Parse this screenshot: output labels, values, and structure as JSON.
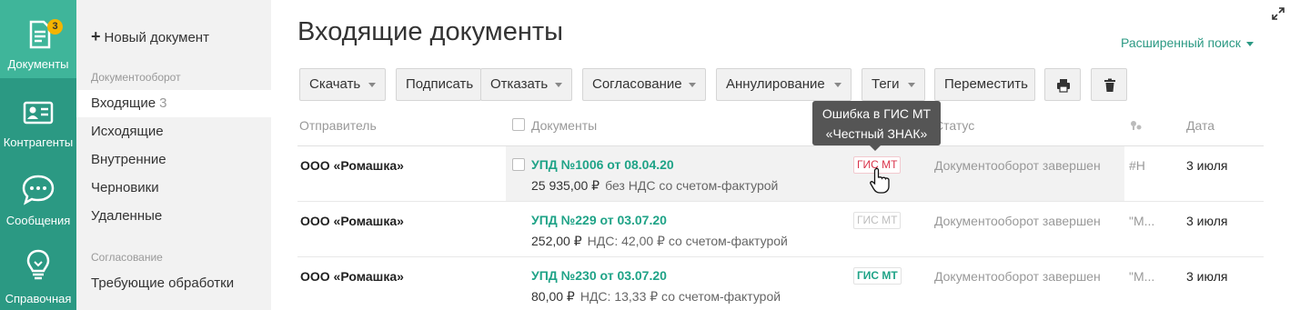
{
  "rail": {
    "items": [
      {
        "label": "Документы",
        "badge": "3",
        "icon": "document-icon",
        "active": true
      },
      {
        "label": "Контрагенты",
        "icon": "contacts-card-icon"
      },
      {
        "label": "Сообщения",
        "icon": "chat-bubble-icon"
      },
      {
        "label": "Справочная",
        "icon": "lightbulb-icon"
      }
    ]
  },
  "nav": {
    "new_doc": "Новый документ",
    "group1": "Документооборот",
    "items": [
      {
        "label": "Входящие",
        "count": "3"
      },
      {
        "label": "Исходящие"
      },
      {
        "label": "Внутренние"
      },
      {
        "label": "Черновики"
      },
      {
        "label": "Удаленные"
      }
    ],
    "group2": "Согласование",
    "items2": [
      {
        "label": "Требующие обработки"
      }
    ]
  },
  "page": {
    "title": "Входящие документы",
    "adv_search": "Расширенный поиск"
  },
  "toolbar": {
    "download": "Скачать",
    "sign": "Подписать",
    "reject": "Отказать",
    "approval": "Согласование",
    "annul": "Аннулирование",
    "tags": "Теги",
    "move": "Переместить",
    "print_icon": "printer-icon",
    "delete_icon": "trash-icon"
  },
  "table": {
    "headers": {
      "sender": "Отправитель",
      "documents": "Документы",
      "status": "Статус",
      "date": "Дата"
    },
    "rows": [
      {
        "sender": "ООО «Ромашка»",
        "title": "УПД №1006 от 08.04.20",
        "amount": "25 935,00 ₽",
        "vat": "без НДС со счетом-фактурой",
        "gis": "ГИС МТ",
        "gis_state": "error",
        "status": "Документооборот завершен",
        "tag": "#Н",
        "date": "3 июля"
      },
      {
        "sender": "ООО «Ромашка»",
        "title": "УПД №229 от 03.07.20",
        "amount": "252,00 ₽",
        "vat": "НДС: 42,00 ₽ со счетом-фактурой",
        "gis": "ГИС МТ",
        "gis_state": "neutral",
        "status": "Документооборот завершен",
        "tag": "\"М...",
        "date": "3 июля"
      },
      {
        "sender": "ООО «Ромашка»",
        "title": "УПД №230 от 03.07.20",
        "amount": "80,00 ₽",
        "vat": "НДС: 13,33 ₽ со счетом-фактурой",
        "gis": "ГИС МТ",
        "gis_state": "ok",
        "status": "Документооборот завершен",
        "tag": "\"М...",
        "date": "3 июля"
      }
    ]
  },
  "tooltip": {
    "line1": "Ошибка в ГИС МТ",
    "line2": "«Честный ЗНАК»"
  },
  "colors": {
    "rail": "#2b9983",
    "rail_active": "#3fb59a",
    "accent": "#1fa387",
    "gis_error": "#d9334a",
    "gis_ok": "#1fa387",
    "gis_neutral": "#bdbdbd"
  }
}
